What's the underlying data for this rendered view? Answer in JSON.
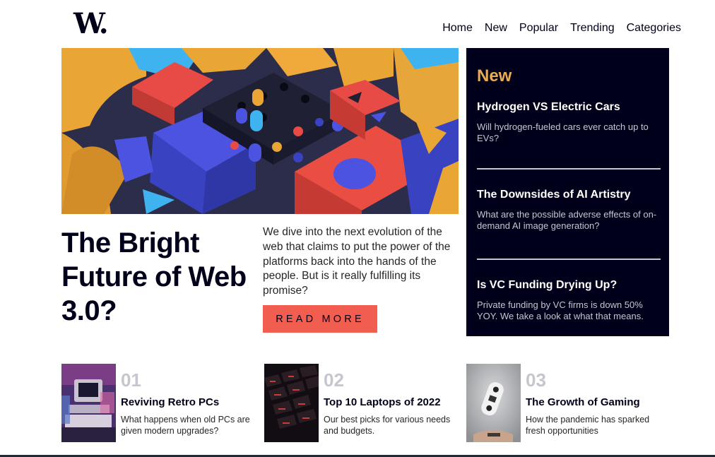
{
  "header": {
    "logo": "W.",
    "nav": [
      "Home",
      "New",
      "Popular",
      "Trending",
      "Categories"
    ]
  },
  "hero": {
    "title": "The Bright Future of Web 3.0?",
    "description": "We dive into the next evolution of the web that claims to put the power of the platforms back into the hands of the people. But is it really fulfilling its promise?",
    "cta": "READ MORE"
  },
  "new_panel": {
    "heading": "New",
    "items": [
      {
        "title": "Hydrogen VS Electric Cars",
        "description": "Will hydrogen-fueled cars ever catch up to EVs?"
      },
      {
        "title": "The Downsides of AI Artistry",
        "description": "What are the possible adverse effects of on-demand AI image generation?"
      },
      {
        "title": "Is VC Funding Drying Up?",
        "description": "Private funding by VC firms is down 50% YOY. We take a look at what that means."
      }
    ]
  },
  "bottom": [
    {
      "number": "01",
      "title": "Reviving Retro PCs",
      "description": "What happens when old PCs are given modern upgrades?"
    },
    {
      "number": "02",
      "title": "Top 10 Laptops of 2022",
      "description": "Our best picks for various needs and budgets."
    },
    {
      "number": "03",
      "title": "The Growth of Gaming",
      "description": "How the pandemic has sparked fresh opportunities"
    }
  ],
  "colors": {
    "dark_blue": "#00001a",
    "soft_orange": "#e9ab53",
    "soft_red": "#f15e50",
    "grayish_blue": "#c5c6ce"
  }
}
